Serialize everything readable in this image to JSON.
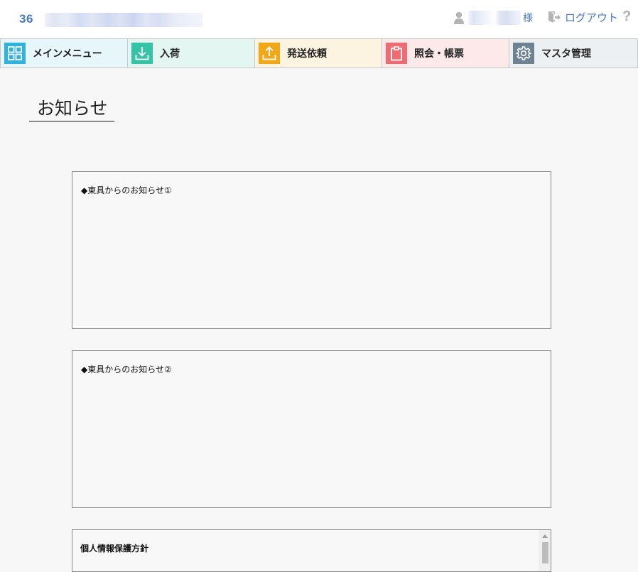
{
  "header": {
    "company_code": "36",
    "honorific": "様",
    "logout_label": "ログアウト",
    "help_label": "?"
  },
  "nav": {
    "items": [
      {
        "label": "メインメニュー",
        "icon": "grid-icon",
        "bg": "#e6f6fb",
        "icon_color": "#2fb2dd"
      },
      {
        "label": "入荷",
        "icon": "download-icon",
        "bg": "#e3f6f1",
        "icon_color": "#35c3a6"
      },
      {
        "label": "発送依頼",
        "icon": "upload-icon",
        "bg": "#fdf3e1",
        "icon_color": "#f0a818"
      },
      {
        "label": "照会・帳票",
        "icon": "clipboard-icon",
        "bg": "#fde9ea",
        "icon_color": "#ee6b72"
      },
      {
        "label": "マスタ管理",
        "icon": "gear-icon",
        "bg": "#edf0f3",
        "icon_color": "#6d8393"
      }
    ]
  },
  "main": {
    "page_title": "お知らせ",
    "notices": [
      {
        "heading": "◆東具からのお知らせ①"
      },
      {
        "heading": "◆東具からのお知らせ②"
      }
    ],
    "policy": {
      "heading": "個人情報保護方針"
    }
  },
  "colors": {
    "accent_blue": "#4a78c2",
    "page_bg": "#f7f7f7"
  }
}
